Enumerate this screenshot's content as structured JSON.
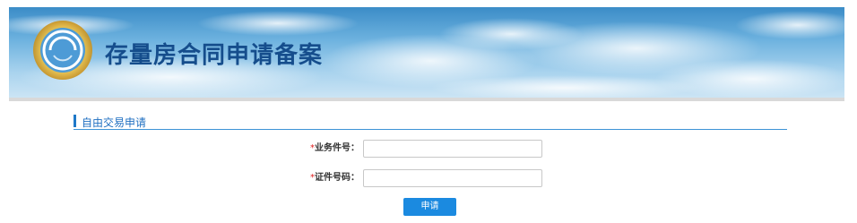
{
  "banner": {
    "title": "存量房合同申请备案",
    "logo_icon": "emblem-icon"
  },
  "section": {
    "title": "自由交易申请"
  },
  "form": {
    "fields": [
      {
        "required_mark": "*",
        "label": "业务件号：",
        "value": "",
        "placeholder": ""
      },
      {
        "required_mark": "*",
        "label": "证件号码：",
        "value": "",
        "placeholder": ""
      }
    ],
    "submit_label": "申请"
  },
  "colors": {
    "title": "#154d8c",
    "accent": "#1f78c8",
    "button": "#1b8ae0",
    "required": "#e02020"
  }
}
